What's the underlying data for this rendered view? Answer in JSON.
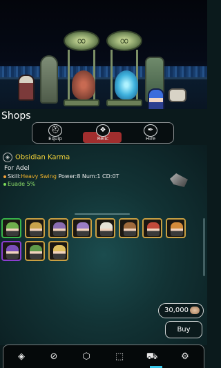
{
  "shop": {
    "title": "Shops",
    "tabs": [
      {
        "label": "Equip",
        "icon": "helmet-icon",
        "active": false
      },
      {
        "label": "Relic",
        "icon": "relic-gem-icon",
        "active": true
      },
      {
        "label": "Hire",
        "icon": "quill-icon",
        "active": false
      }
    ]
  },
  "item": {
    "name": "Obsidian Karma",
    "owner": "For Adel",
    "skill_prefix": "Skill:",
    "skill_name": "Heavy Swing",
    "skill_stats": " Power:8 Num:1 CD:0T",
    "evade": "Euade 5%",
    "icon": "info-icon",
    "name_color": "#f2d23a",
    "skill_color": "#f2b32a",
    "evade_color": "#8ee06a"
  },
  "heroes": [
    {
      "icon": "hero-green-icon",
      "border": "#39b54a"
    },
    {
      "icon": "hero-gold-icon",
      "border": "#c9a043"
    },
    {
      "icon": "hero-purple-icon",
      "border": "#c9a043"
    },
    {
      "icon": "hero-purple-staff-icon",
      "border": "#c9a043"
    },
    {
      "icon": "hero-white-icon",
      "border": "#c9a043"
    },
    {
      "icon": "hero-brown-icon",
      "border": "#c9a043"
    },
    {
      "icon": "hero-red-icon",
      "border": "#c9a043"
    },
    {
      "icon": "hero-orange-icon",
      "border": "#c9a043"
    },
    {
      "icon": "hero-mage-icon",
      "border": "#8b3fd1"
    },
    {
      "icon": "hero-ranger-icon",
      "border": "#c9a043"
    },
    {
      "icon": "hero-blonde-icon",
      "border": "#c9a043"
    }
  ],
  "purchase": {
    "price": "30,000",
    "currency_icon": "coin-icon",
    "buy_label": "Buy"
  },
  "nav": [
    {
      "icon": "diamond-icon",
      "active": false
    },
    {
      "icon": "compass-icon",
      "active": false
    },
    {
      "icon": "hexagon-icon",
      "active": false
    },
    {
      "icon": "box-icon",
      "active": false
    },
    {
      "icon": "cart-icon",
      "active": true
    },
    {
      "icon": "settings-icon",
      "active": false
    }
  ],
  "colors": {
    "active_tab": "#a12e2e",
    "nav_active": "#37c6e8"
  }
}
